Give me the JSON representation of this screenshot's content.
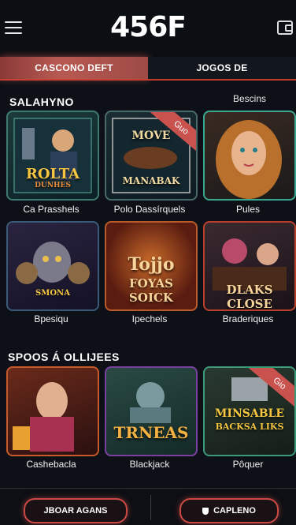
{
  "header": {
    "logo": "456F"
  },
  "tabs": [
    {
      "label": "CASCONO DEFT"
    },
    {
      "label": "JOGOS DE"
    }
  ],
  "section1": {
    "title": "SALAHYNO",
    "side": "Bescins",
    "tiles": [
      {
        "label": "Ca Prasshels",
        "art": [
          "ROLTA",
          "DUNHES"
        ]
      },
      {
        "label": "Polo Dassírquels",
        "art": [
          "MOVE",
          "MANABAK"
        ],
        "ribbon": "Guo"
      },
      {
        "label": "Pules",
        "art": []
      },
      {
        "label": "Bpesiqu",
        "art": [
          "SMONA"
        ]
      },
      {
        "label": "Ipechels",
        "art": [
          "Tojjo",
          "FOYAS SOICK"
        ]
      },
      {
        "label": "Braderiques",
        "art": [
          "DLAKS CLOSE"
        ]
      }
    ]
  },
  "section2": {
    "title": "SPOOS Á OLLIJEES",
    "tiles": [
      {
        "label": "Cashebacla",
        "art": []
      },
      {
        "label": "Blackjack",
        "art": [
          "TRNEAS"
        ]
      },
      {
        "label": "Pôquer",
        "art": [
          "MINSABLE",
          "BACKSA LIKS"
        ],
        "ribbon": "Gio"
      }
    ]
  },
  "bottom": {
    "left_button": "JBOAR AGANS",
    "right_button": "CAPLENO"
  }
}
